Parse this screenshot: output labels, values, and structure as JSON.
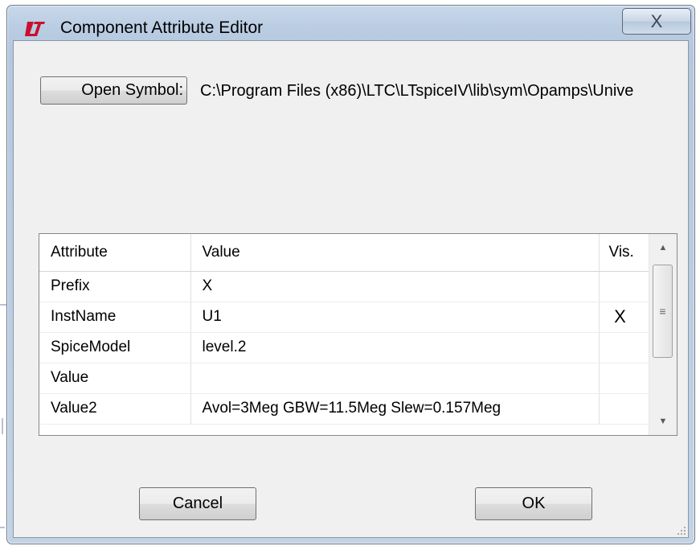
{
  "window": {
    "title": "Component Attribute Editor",
    "close_glyph": "X",
    "app_icon": "ltspice-logo-icon"
  },
  "open_symbol": {
    "button_label": "Open Symbol:",
    "path": "C:\\Program Files (x86)\\LTC\\LTspiceIV\\lib\\sym\\Opamps\\Unive"
  },
  "grid": {
    "headers": [
      "Attribute",
      "Value",
      "Vis."
    ],
    "rows": [
      {
        "attribute": "Prefix",
        "value": "X",
        "vis": ""
      },
      {
        "attribute": "InstName",
        "value": "U1",
        "vis": "X"
      },
      {
        "attribute": "SpiceModel",
        "value": "level.2",
        "vis": ""
      },
      {
        "attribute": "Value",
        "value": "",
        "vis": ""
      },
      {
        "attribute": "Value2",
        "value": "Avol=3Meg GBW=11.5Meg Slew=0.157Meg",
        "vis": ""
      }
    ]
  },
  "buttons": {
    "cancel": "Cancel",
    "ok": "OK"
  },
  "colors": {
    "title_bar": "#b9cce2",
    "client": "#f0f0f0",
    "logo_red": "#c8102e"
  }
}
